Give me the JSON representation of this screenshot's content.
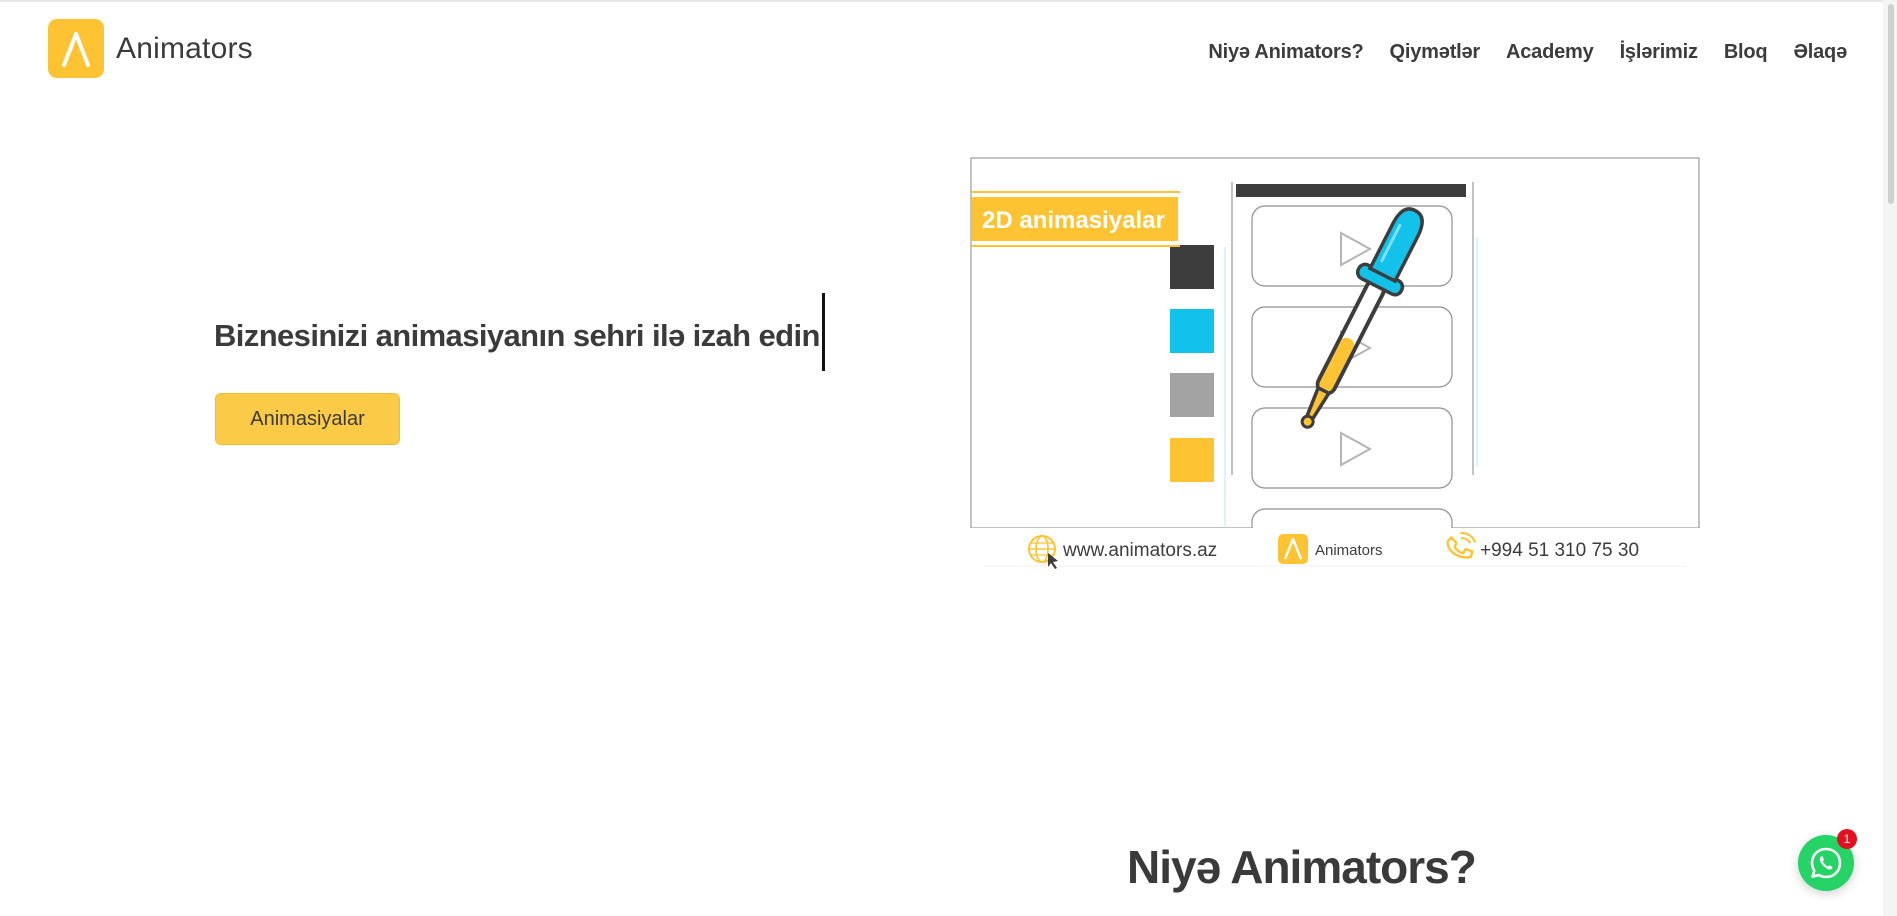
{
  "brand": {
    "name": "Animators",
    "accent": "#fdc332"
  },
  "nav": {
    "items": [
      "Niyə Animators?",
      "Qiymətlər",
      "Academy",
      "İşlərimiz",
      "Bloq",
      "Əlaqə"
    ]
  },
  "hero": {
    "title": "Biznesinizi animasiyanın sehri ilə izah edin",
    "cta_label": "Animasiyalar"
  },
  "illustration": {
    "label": "2D animasiyalar",
    "website": "www.animators.az",
    "brand_name": "Animators",
    "phone": "+994 51 310 75 30",
    "swatches": [
      "#3d3d3d",
      "#12c2ea",
      "#a3a3a3",
      "#fdc332"
    ]
  },
  "section": {
    "title": "Niyə Animators?"
  },
  "whatsapp": {
    "badge": "1",
    "color": "#25d366"
  },
  "icons": [
    "logo-a-icon",
    "globe-icon",
    "phone-icon",
    "play-icon",
    "dropper-icon",
    "whatsapp-icon"
  ]
}
